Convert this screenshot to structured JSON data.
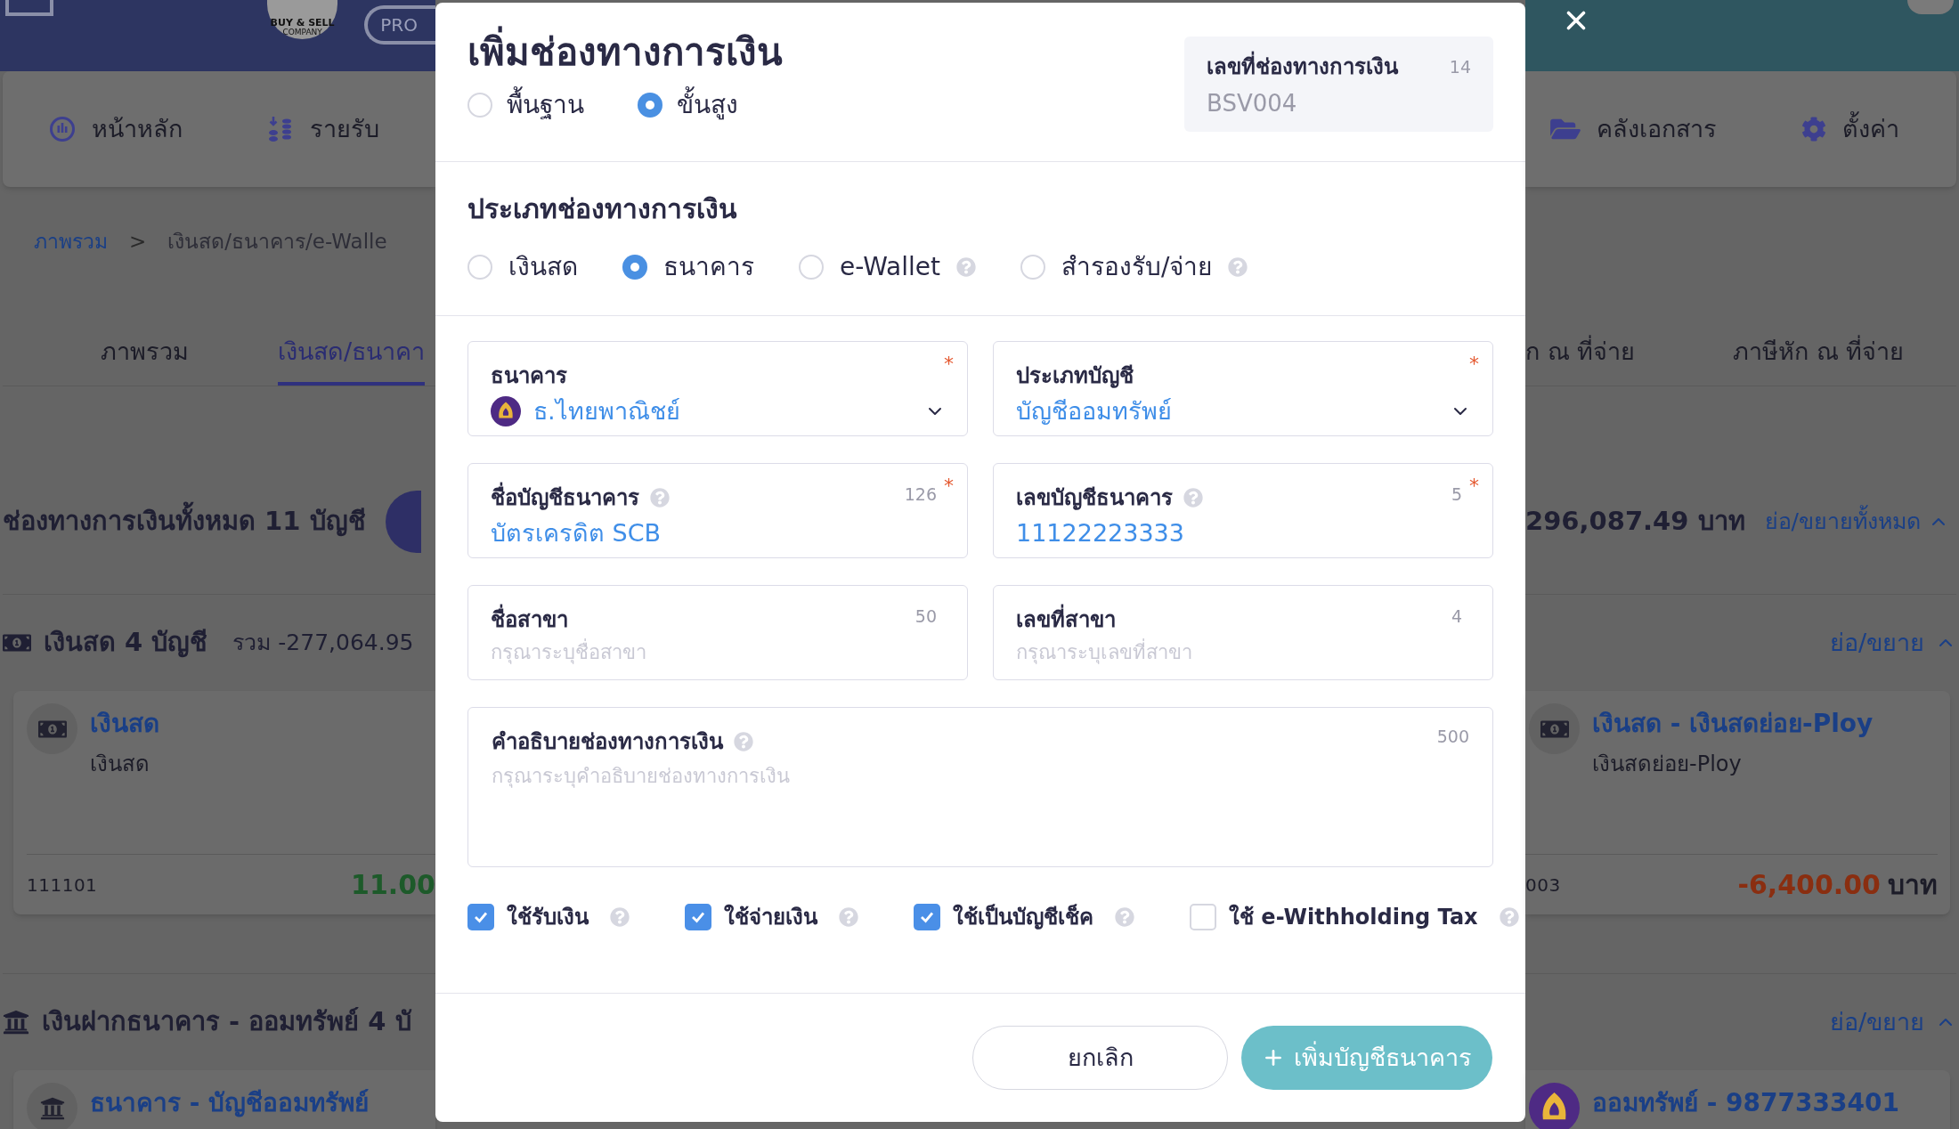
{
  "header": {
    "company_logo": {
      "line1": "BUY & SELL",
      "line2": "COMPANY"
    },
    "badge": "PRO"
  },
  "nav_left": [
    {
      "kind": "home",
      "label": "หน้าหลัก"
    },
    {
      "kind": "income",
      "label": "รายรับ"
    }
  ],
  "nav_right": [
    {
      "kind": "documents",
      "label": "คลังเอกสาร"
    },
    {
      "kind": "settings",
      "label": "ตั้งค่า"
    }
  ],
  "breadcrumb": {
    "link": "ภาพรวม",
    "separator": ">",
    "current": "เงินสด/ธนาคาร/e-Walle"
  },
  "tabs_left": [
    {
      "label": "ภาพรวม",
      "selected": false
    },
    {
      "label": "เงินสด/ธนาคา",
      "selected": true
    }
  ],
  "tabs_right": [
    {
      "label": "ก ณ ที่จ่าย",
      "selected": false
    },
    {
      "label": "ภาษีหัก ณ ที่จ่าย",
      "selected": false
    }
  ],
  "summary": {
    "title": "ช่องทางการเงินทั้งหมด 11 บัญชี",
    "total": "296,087.49 บาท",
    "toggle_all": "ย่อ/ขยายทั้งหมด"
  },
  "sections": [
    {
      "kind": "cash",
      "title": "เงินสด 4 บัญชี",
      "total": "รวม -277,064.95",
      "toggle": "ย่อ/ขยาย",
      "left_card": {
        "kind": "cash",
        "title": "เงินสด",
        "subtitle": "เงินสด",
        "code": "111101",
        "amount": "11.00",
        "color": "#1d5a2a"
      },
      "right_card": {
        "kind": "cash",
        "title": "เงินสด - เงินสดย่อย-Ploy",
        "subtitle": "เงินสดย่อย-Ploy",
        "code": "003",
        "amount": "-6,400.00",
        "unit": "บาท",
        "color": "#8a2e10"
      }
    },
    {
      "kind": "bank",
      "title": "เงินฝากธนาคาร - ออมทรัพย์ 4 บั",
      "toggle": "ย่อ/ขยาย",
      "left_card": {
        "kind": "bank",
        "title": "ธนาคาร - บัญชีออมทรัพย์"
      },
      "right_card": {
        "kind": "scb",
        "title": "ออมทรัพย์ - 9877333401"
      }
    }
  ],
  "dialog": {
    "title": "เพิ่มช่องทางการเงิน",
    "modes": [
      {
        "label": "พื้นฐาน",
        "selected": false
      },
      {
        "label": "ขั้นสูง",
        "selected": true
      }
    ],
    "code_box": {
      "label": "เลขที่ช่องทางการเงิน",
      "counter": "14",
      "value": "BSV004"
    },
    "type_heading": "ประเภทช่องทางการเงิน",
    "types": [
      {
        "label": "เงินสด",
        "selected": false,
        "help": false
      },
      {
        "label": "ธนาคาร",
        "selected": true,
        "help": false
      },
      {
        "label": "e-Wallet",
        "selected": false,
        "help": true
      },
      {
        "label": "สำรองรับ/จ่าย",
        "selected": false,
        "help": true
      }
    ],
    "fields": [
      {
        "kind": "select",
        "label": "ธนาคาร",
        "value": "ธ.ไทยพาณิชย์",
        "required_mark": "*",
        "logo": true
      },
      {
        "kind": "select",
        "label": "ประเภทบัญชี",
        "value": "บัญชีออมทรัพย์",
        "required_mark": "*",
        "logo": false
      },
      {
        "kind": "text",
        "label": "ชื่อบัญชีธนาคาร",
        "help": true,
        "counter": "126",
        "value": "บัตรเครดิต SCB",
        "required_mark": "*"
      },
      {
        "kind": "text",
        "label": "เลขบัญชีธนาคาร",
        "help": true,
        "counter": "5",
        "value": "11122223333",
        "required_mark": "*"
      },
      {
        "kind": "text",
        "label": "ชื่อสาขา",
        "help": false,
        "counter": "50",
        "placeholder": "กรุณาระบุชื่อสาขา"
      },
      {
        "kind": "text",
        "label": "เลขที่สาขา",
        "help": false,
        "counter": "4",
        "placeholder": "กรุณาระบุเลขที่สาขา"
      }
    ],
    "description": {
      "label": "คำอธิบายช่องทางการเงิน",
      "help": true,
      "counter": "500",
      "placeholder": "กรุณาระบุคำอธิบายช่องทางการเงิน"
    },
    "options": [
      {
        "label": "ใช้รับเงิน",
        "checked": true
      },
      {
        "label": "ใช้จ่ายเงิน",
        "checked": true
      },
      {
        "label": "ใช้เป็นบัญชีเช็ค",
        "checked": true
      },
      {
        "label": "ใช้ e-Withholding Tax",
        "checked": false
      }
    ],
    "cancel": "ยกเลิก",
    "submit": "เพิ่มบัญชีธนาคาร"
  }
}
